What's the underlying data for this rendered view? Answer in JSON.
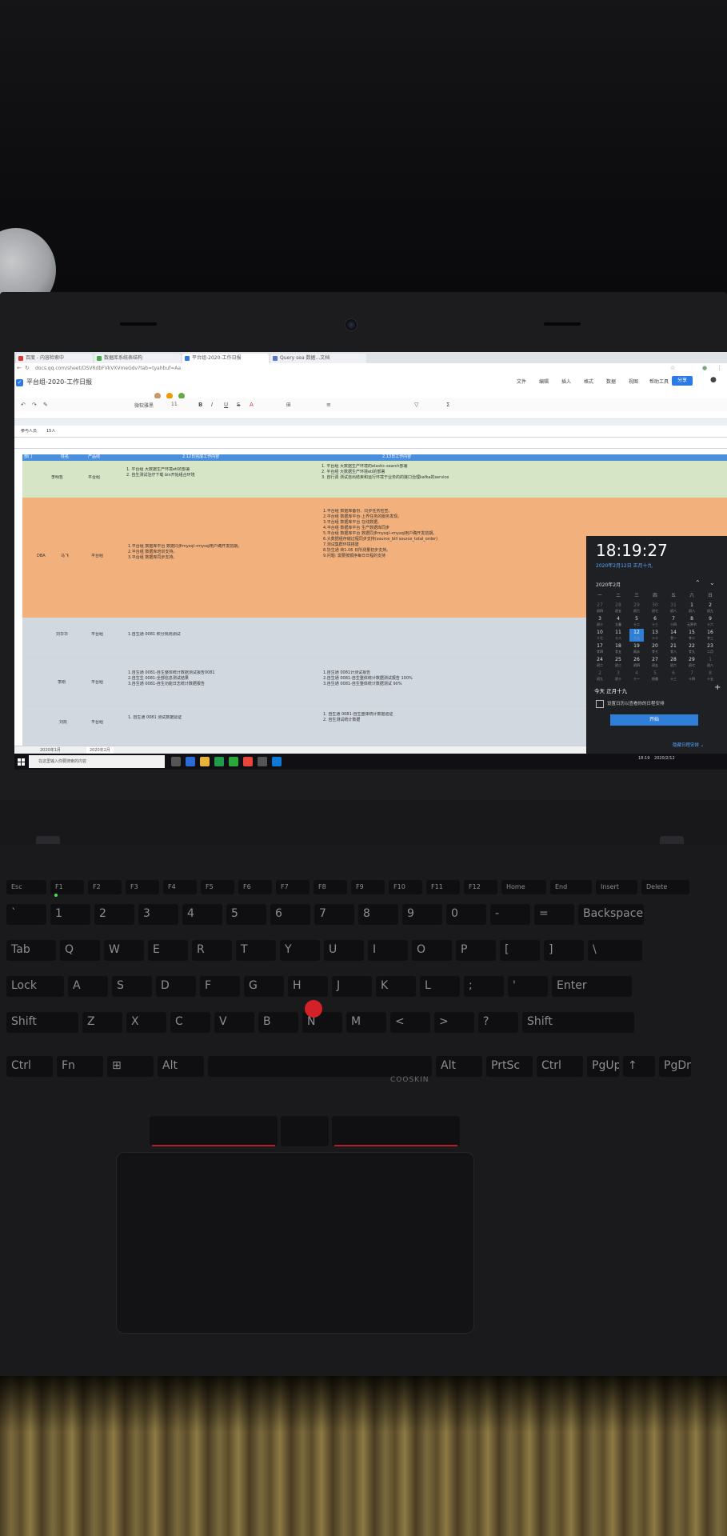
{
  "browser": {
    "tabs": [
      "百度 - 内容检索中",
      "数据库系统表结构",
      "平台组-2020-工作日报",
      "Query sea 数据...文档"
    ],
    "url": "docs.qq.com/sheet/DSVRdbFVkVXVmeGdv?tab=tyahbuf=Aa"
  },
  "doc": {
    "title": "平台组-2020-工作日报",
    "menu": [
      "文件",
      "编辑",
      "插入",
      "格式",
      "数据",
      "视图",
      "帮助工具"
    ],
    "share": "分享",
    "toolbar_font": "微软雅黑",
    "toolbar_size": "11"
  },
  "sheet": {
    "filter_label": "参与人员",
    "filter_value": "15人",
    "header_cols": [
      "部门",
      "姓名",
      "产品线",
      "2.12日完成工作内容",
      "2.13日工作内容"
    ],
    "rows": [
      {
        "dept": "",
        "name": "李明哲",
        "line": "平台组",
        "done": "1. 平台组 大数据生产环境etl的部署\n2. 自生测试治疗下载 bin开始组合环境",
        "plan": "1. 平台组 大数据生产环境的elastic-search部署\n2. 平台组 大数据生产环境etl的部署\n3. 自行调 测试自出结束和运行环境于业务的的接口治理kafka的service"
      },
      {
        "dept": "DBA",
        "name": "马飞",
        "line": "平台组",
        "done": "1.平台组 数据库平台 数据同步mysql→mysql用户确开发前期。\n2.平台组 数据库培训支持。\n3.平台组 数据库同步支持。",
        "plan": "1.平台组 数据库备份、同步任务检查。\n2.平台组 数据库平台-上界任务的服务发现。\n3.平台组 数据库平台 在线数据。\n4.平台组 数据库平台 生产数据库同步\n5.平台组 数据库平台 数据同步mysql→mysql用户确开发前期。\n6.大数据组存储过程同步支持(source_bill source_total_order)\n7.测试集群环境搭建\n8.协生通 转1.06 日所测量初步支持。\n9.问题: 需要按顺序每日日程的支持"
      },
      {
        "dept": "",
        "name": "刘华华",
        "line": "平台组",
        "done": "1.自生通 0081 积分规则测试",
        "plan": ""
      },
      {
        "dept": "",
        "name": "李刚",
        "line": "平台组",
        "done": "1.自生通 0081-自生整体统计数据测试报告0081\n2.自生生 0081-全部信息测试结果\n3.自生通 0081-自生功能日志统计数据报告",
        "plan": "1.自生通 0081计测试报告\n2.自生通 0081-自生整体统计数据测试报告 100%\n3.自生通 0081-自生整体统计数据测试 90%"
      },
      {
        "dept": "",
        "name": "刘凯",
        "line": "平台组",
        "done": "1. 自生通 0081 测试数据验证",
        "plan": "1. 自生通 0081-自生整体统计数据验证\n2. 自生测试统计数据"
      }
    ],
    "tabs": [
      "2020年1月",
      "2020年2月"
    ]
  },
  "taskbar": {
    "search_placeholder": "在这里输入你要搜索的内容",
    "tray_time": "18:19",
    "tray_date": "2020/2/12"
  },
  "calendar": {
    "time": "18:19:27",
    "date_line": "2020年2月12日 正月十九",
    "month_label": "2020年2月",
    "weekdays": [
      "一",
      "二",
      "三",
      "四",
      "五",
      "六",
      "日"
    ],
    "weeks": [
      [
        [
          "27",
          "初四",
          1
        ],
        [
          "28",
          "初五",
          1
        ],
        [
          "29",
          "初六",
          1
        ],
        [
          "30",
          "初七",
          1
        ],
        [
          "31",
          "初八",
          1
        ],
        [
          "1",
          "初八",
          0
        ],
        [
          "2",
          "初九",
          0
        ]
      ],
      [
        [
          "3",
          "初十",
          0
        ],
        [
          "4",
          "立春",
          0
        ],
        [
          "5",
          "十二",
          0
        ],
        [
          "6",
          "十三",
          0
        ],
        [
          "7",
          "十四",
          0
        ],
        [
          "8",
          "元宵节",
          0
        ],
        [
          "9",
          "十六",
          0
        ]
      ],
      [
        [
          "10",
          "十七",
          0
        ],
        [
          "11",
          "十八",
          0
        ],
        [
          "12",
          "十九",
          2
        ],
        [
          "13",
          "二十",
          0
        ],
        [
          "14",
          "廿一",
          0
        ],
        [
          "15",
          "廿二",
          0
        ],
        [
          "16",
          "廿三",
          0
        ]
      ],
      [
        [
          "17",
          "廿四",
          0
        ],
        [
          "18",
          "廿五",
          0
        ],
        [
          "19",
          "雨水",
          0
        ],
        [
          "20",
          "廿七",
          0
        ],
        [
          "21",
          "廿八",
          0
        ],
        [
          "22",
          "廿九",
          0
        ],
        [
          "23",
          "二月",
          0
        ]
      ],
      [
        [
          "24",
          "初二",
          0
        ],
        [
          "25",
          "初三",
          0
        ],
        [
          "26",
          "初四",
          0
        ],
        [
          "27",
          "初五",
          0
        ],
        [
          "28",
          "初六",
          0
        ],
        [
          "29",
          "初七",
          0
        ],
        [
          "1",
          "初八",
          1
        ]
      ],
      [
        [
          "2",
          "初九",
          1
        ],
        [
          "3",
          "初十",
          1
        ],
        [
          "4",
          "十一",
          1
        ],
        [
          "5",
          "惊蛰",
          1
        ],
        [
          "6",
          "十三",
          1
        ],
        [
          "7",
          "十四",
          1
        ],
        [
          "8",
          "十五",
          1
        ]
      ]
    ],
    "agenda_title": "今天 正月十九",
    "agenda_text": "设置日历以查看你的日程安排",
    "agenda_button": "开始",
    "hide_agenda": "隐藏日程安排 ⌄"
  },
  "laptop": {
    "keyboard_brand": "COOSKIN",
    "keys_row1": [
      "Esc",
      "F1",
      "F2",
      "F3",
      "F4",
      "F5",
      "F6",
      "F7",
      "F8",
      "F9",
      "F10",
      "F11",
      "F12",
      "Home",
      "End",
      "Insert",
      "Delete"
    ],
    "keys_num": [
      "`",
      "1",
      "2",
      "3",
      "4",
      "5",
      "6",
      "7",
      "8",
      "9",
      "0",
      "-",
      "=",
      "Backspace"
    ],
    "keys_q": [
      "Tab",
      "Q",
      "W",
      "E",
      "R",
      "T",
      "Y",
      "U",
      "I",
      "O",
      "P",
      "[",
      "]",
      "\\"
    ],
    "keys_a": [
      "Lock",
      "A",
      "S",
      "D",
      "F",
      "G",
      "H",
      "J",
      "K",
      "L",
      ";",
      "'",
      "Enter"
    ],
    "keys_z": [
      "Shift",
      "Z",
      "X",
      "C",
      "V",
      "B",
      "N",
      "M",
      "<",
      ">",
      "?",
      "Shift"
    ],
    "keys_bottom": [
      "Ctrl",
      "Fn",
      "⊞",
      "Alt",
      "",
      "Alt",
      "PrtSc",
      "Ctrl",
      "PgUp",
      "↑",
      "PgDn"
    ]
  },
  "colors": {
    "accent": "#2b79e4",
    "header_blue": "#4a8fdc",
    "row_green": "#d6e5c6",
    "row_orange": "#f2b07c",
    "row_grey": "#d2d8e0",
    "trackpoint": "#d42027"
  }
}
